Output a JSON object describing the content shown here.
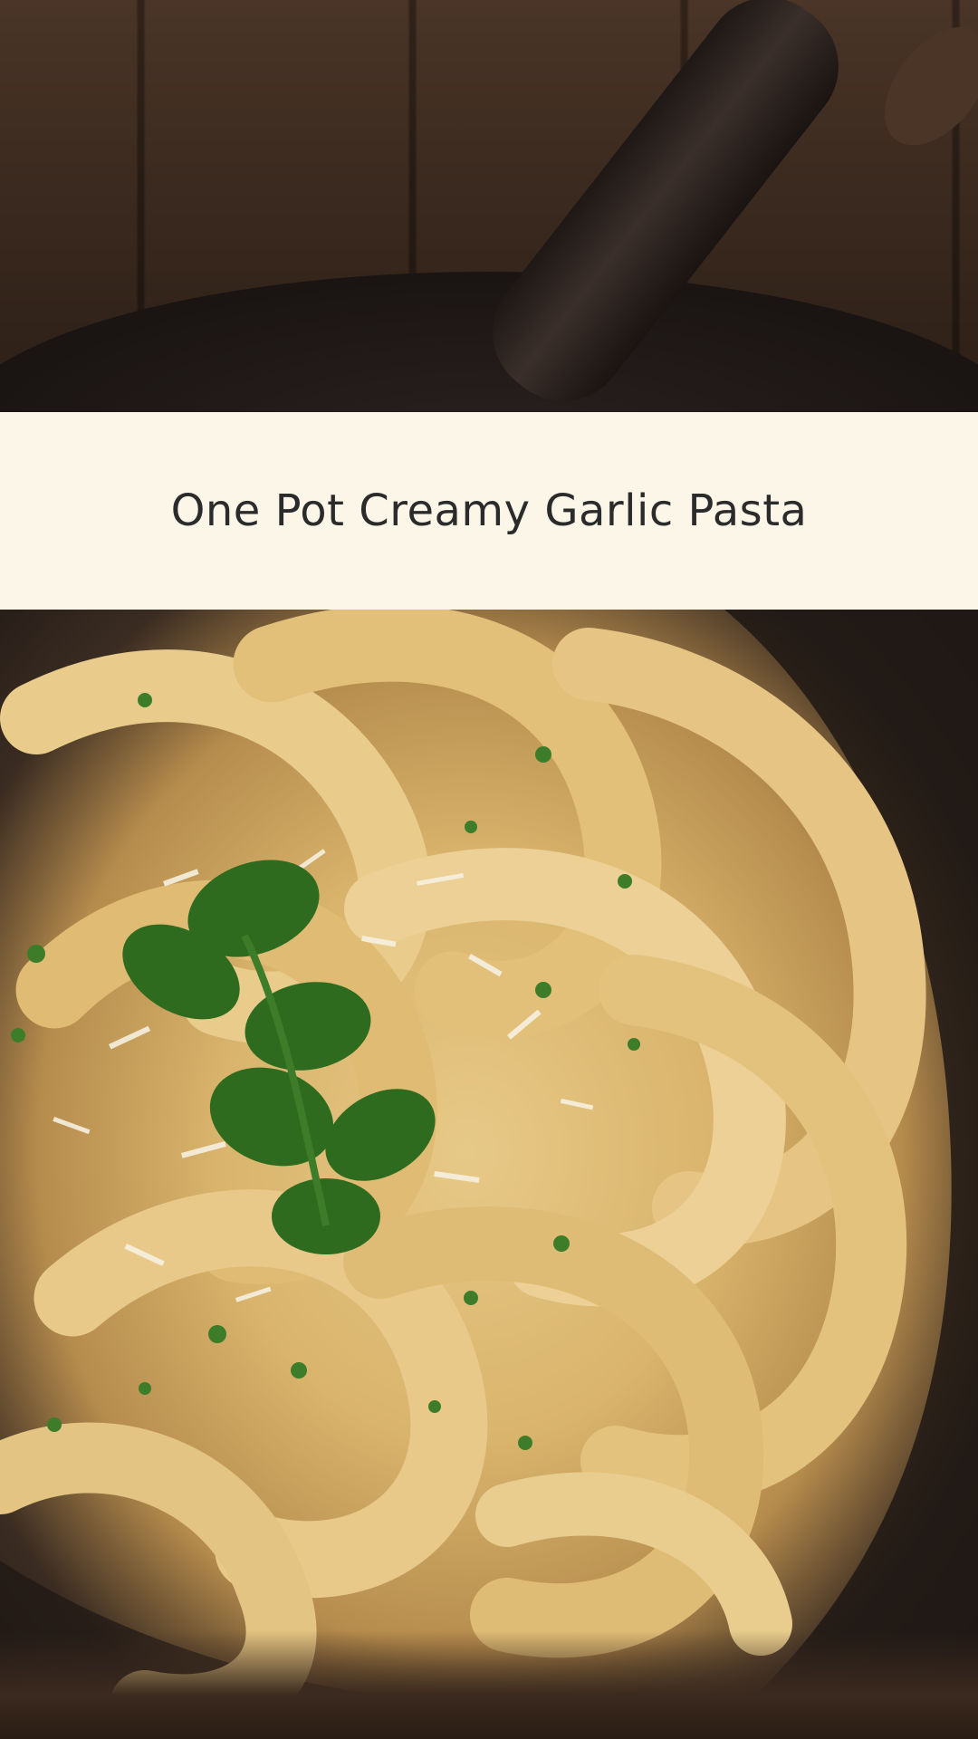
{
  "title": "One Pot Creamy Garlic Pasta",
  "colors": {
    "banner_background": "#fcf6e8",
    "title_text": "#2b2b2b",
    "pasta": "#e3c07c",
    "skillet": "#1e1714",
    "parsley": "#2f6b1f",
    "wood": "#3b2a1f"
  },
  "images": {
    "top": "wooden-table-with-cast-iron-skillet-handle",
    "bottom": "pappardelle-pasta-with-parmesan-and-parsley-in-cast-iron-skillet"
  }
}
